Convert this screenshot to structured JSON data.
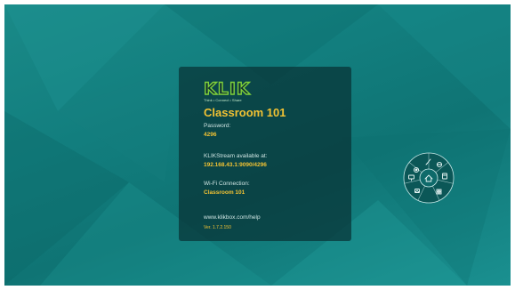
{
  "app": {
    "logo_text": "KLIK",
    "tagline": "Think • Connect • Share"
  },
  "card": {
    "room_name": "Classroom 101",
    "password_label": "Password:",
    "password_value": "4296",
    "stream_label": "KLIKStream available at:",
    "stream_value": "192.168.43.1:9090/4296",
    "wifi_label": "Wi-Fi Connection:",
    "wifi_value": "Classroom 101",
    "help_url": "www.klikbox.com/help",
    "version": "Ver. 1.7.2.150"
  },
  "wheel": {
    "items": [
      {
        "icon": "settings-icon"
      },
      {
        "icon": "whiteboard-icon"
      },
      {
        "icon": "browser-icon"
      },
      {
        "icon": "files-icon"
      },
      {
        "icon": "apps-icon"
      },
      {
        "icon": "media-icon"
      },
      {
        "icon": "screenshare-icon"
      }
    ],
    "center_icon": "home-icon"
  },
  "colors": {
    "background": "#127e7e",
    "accent_yellow": "#f2c233",
    "logo_green": "#7fd13b"
  }
}
